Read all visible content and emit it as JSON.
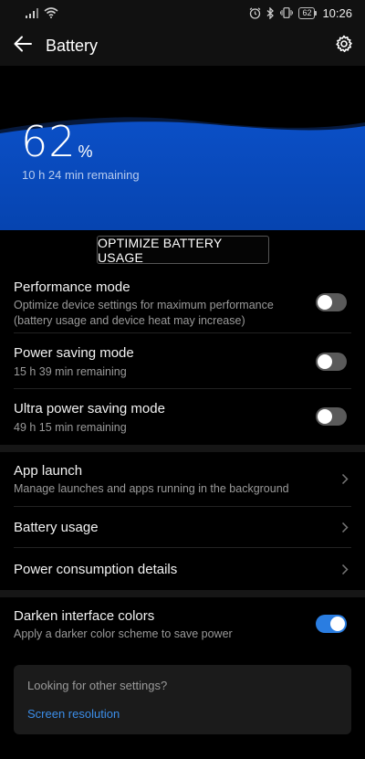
{
  "status_bar": {
    "time": "10:26",
    "battery_level": "62"
  },
  "app_bar": {
    "title": "Battery"
  },
  "battery": {
    "percent": "62",
    "percent_sign": "%",
    "remaining": "10 h 24 min remaining"
  },
  "optimize_button": "OPTIMIZE BATTERY USAGE",
  "modes": [
    {
      "title": "Performance mode",
      "subtitle_line1": "Optimize device settings for maximum performance",
      "subtitle_line2": "(battery usage and device heat may increase)",
      "enabled": false
    },
    {
      "title": "Power saving mode",
      "subtitle": "15 h 39 min remaining",
      "enabled": false
    },
    {
      "title": "Ultra power saving mode",
      "subtitle": "49 h 15 min remaining",
      "enabled": false
    }
  ],
  "nav_items": [
    {
      "title": "App launch",
      "subtitle": "Manage launches and apps running in the background"
    },
    {
      "title": "Battery usage"
    },
    {
      "title": "Power consumption details"
    }
  ],
  "darken": {
    "title": "Darken interface colors",
    "subtitle": "Apply a darker color scheme to save power",
    "enabled": true
  },
  "footer": {
    "question": "Looking for other settings?",
    "link": "Screen resolution"
  },
  "colors": {
    "accent": "#2a7de1",
    "link": "#3b8de8",
    "wave": "#0a4cc0"
  }
}
